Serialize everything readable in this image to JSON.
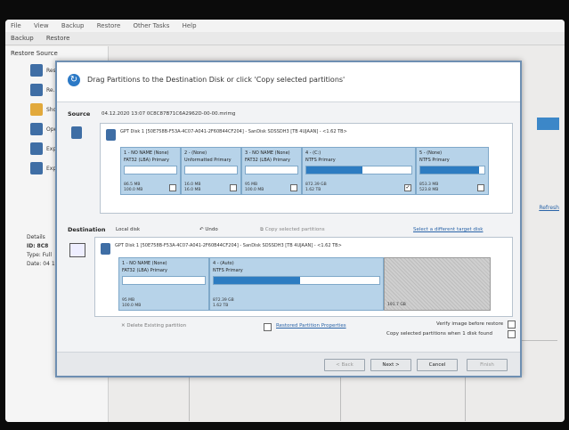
{
  "app": {
    "menu": [
      "File",
      "View",
      "Backup",
      "Restore",
      "Other Tasks",
      "Help"
    ],
    "toolbar": [
      "Backup",
      "Restore"
    ],
    "panel_header": "Restore Source",
    "left_items": [
      "Restore",
      "Re...",
      "Show",
      "Ope...",
      "Expl...",
      "Expl..."
    ],
    "detail_group": "Details",
    "detail_id_label": "ID:",
    "detail_id_value": "8C8",
    "detail_type_label": "Type:",
    "detail_type_value": "Full",
    "detail_date_label": "Date:",
    "detail_date_value": "04 1",
    "right_link": "Refresh"
  },
  "dialog": {
    "title": "Drag Partitions to the Destination Disk or click 'Copy selected partitions'",
    "source_label": "Source",
    "source_info": "04.12.2020 13:07    0C8C87B71C6A2962D-00-00.mrimg",
    "source_disk": {
      "header": "GPT Disk 1 [50E758B-F53A-4C07-A041-2F60B44CF204] - SanDisk SDSSDH3 [TB 4UJAAN] - <1.62 TB>",
      "partitions": [
        {
          "name": "1 - NO NAME (None)",
          "type": "FAT32 (LBA) Primary",
          "used": "86.5 MB",
          "free": "100.0 MB",
          "fill": 0,
          "checked": false
        },
        {
          "name": "2 - (None)",
          "type": "Unformatted Primary",
          "used": "16.0 MB",
          "free": "16.0 MB",
          "fill": 0,
          "checked": false
        },
        {
          "name": "3 - NO NAME (None)",
          "type": "FAT32 (LBA) Primary",
          "used": "95 MB",
          "free": "100.0 MB",
          "fill": 0,
          "checked": false
        },
        {
          "name": "4 - (C:)",
          "type": "NTFS Primary",
          "used": "872.39 GB",
          "free": "1.62 TB",
          "fill": 0.53,
          "checked": true
        },
        {
          "name": "5 - (None)",
          "type": "NTFS Primary",
          "used": "853.3 MB",
          "free": "523.8 MB",
          "fill": 0.92,
          "checked": false
        }
      ]
    },
    "destination_label": "Destination",
    "destination_sub": "Local disk",
    "undo_label": "Undo",
    "copy_selected_label": "Copy selected partitions",
    "select_target_link": "Select a different target disk",
    "dest_disk": {
      "header": "GPT Disk 1 [50E758B-F53A-4C07-A041-2F60B44CF204] - SanDisk SDSSDH3 [TB 4UJAAN] - <1.62 TB>",
      "partitions": [
        {
          "name": "1 - NO NAME (None)",
          "type": "FAT32 (LBA) Primary",
          "used": "95 MB",
          "free": "100.0 MB",
          "fill": 0
        },
        {
          "name": "4 - (Auto)",
          "type": "NTFS Primary",
          "used": "872.39 GB",
          "free": "1.62 TB",
          "fill": 0.52
        }
      ],
      "unallocated_free": "191.7 GB"
    },
    "delete_label": "Delete Existing partition",
    "props_label": "Restored Partition Properties",
    "verify_label": "Verify image before restore",
    "copy_when_label": "Copy selected partitions when 1 disk found",
    "buttons": [
      "< Back",
      "Next >",
      "Cancel",
      "Finish"
    ]
  }
}
